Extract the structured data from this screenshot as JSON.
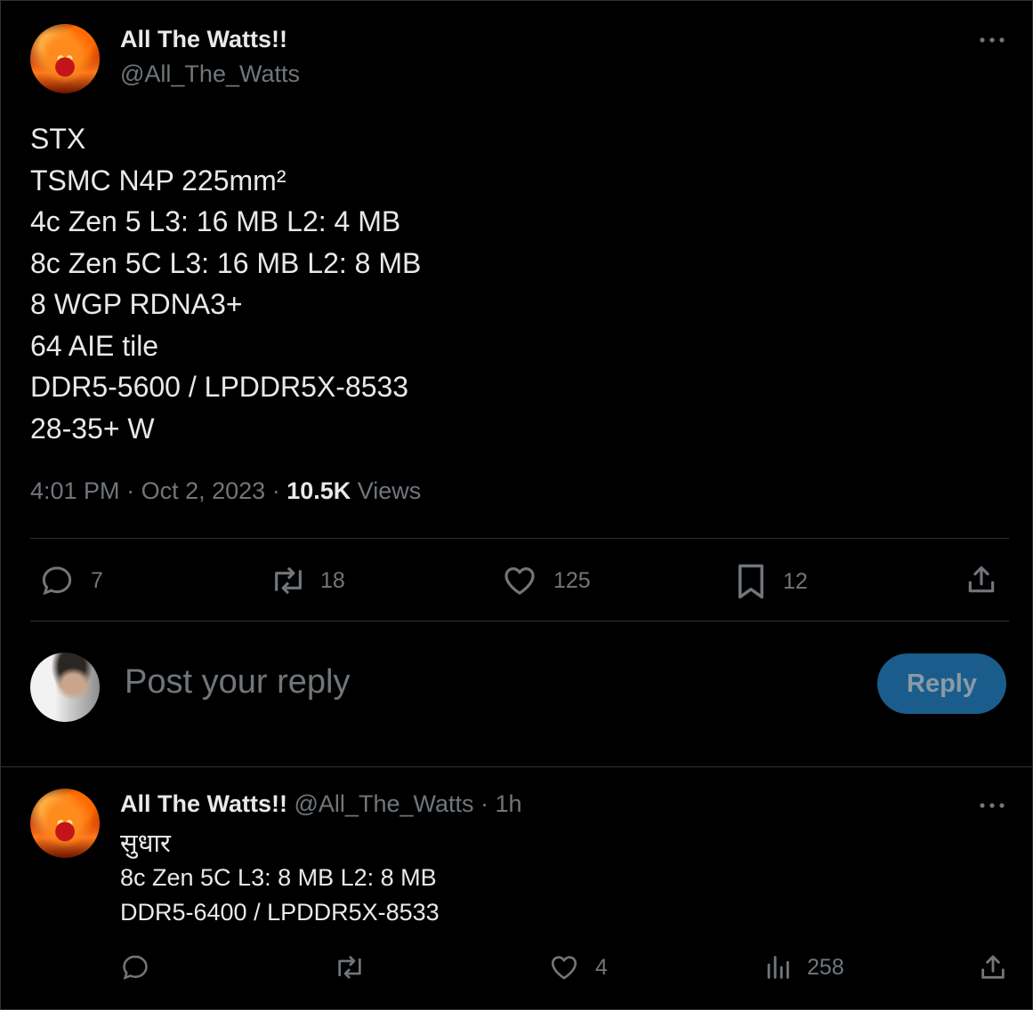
{
  "tweet": {
    "author_name": "All The Watts!!",
    "author_handle": "@All_The_Watts",
    "lines": [
      "STX",
      "TSMC N4P 225mm²",
      "4c Zen 5 L3: 16 MB L2: 4 MB",
      "8c Zen 5C L3: 16 MB L2: 8 MB",
      "8 WGP RDNA3+",
      "64 AIE tile",
      "DDR5-5600 / LPDDR5X-8533",
      "28-35+ W"
    ],
    "time": "4:01 PM",
    "date": "Oct 2, 2023",
    "views_count": "10.5K",
    "views_label": "Views",
    "replies": "7",
    "reposts": "18",
    "likes": "125",
    "bookmarks": "12"
  },
  "composer": {
    "placeholder": "Post your reply",
    "button_label": "Reply"
  },
  "reply": {
    "author_name": "All The Watts!!",
    "author_handle": "@All_The_Watts",
    "time": "1h",
    "lines": [
      "सुधार",
      "8c Zen 5C L3: 8 MB L2: 8 MB",
      "DDR5-6400 / LPDDR5X-8533"
    ],
    "likes": "4",
    "views": "258"
  },
  "colors": {
    "background": "#000000",
    "text": "#e7e9ea",
    "muted": "#71767b",
    "divider": "#2f3336",
    "reply_button": "#1a5d8c"
  }
}
